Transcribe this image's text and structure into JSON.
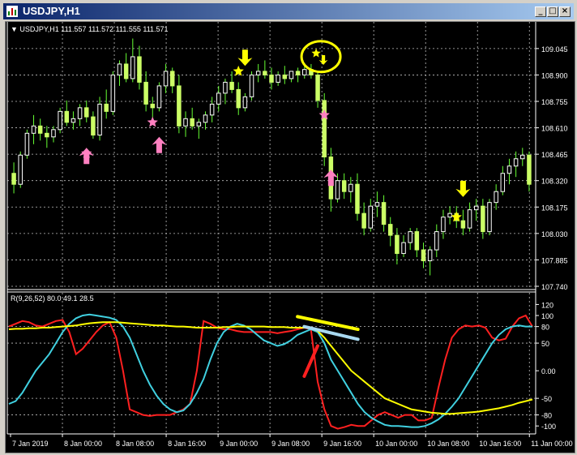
{
  "window": {
    "title": "USDJPY,H1"
  },
  "chart_data": [
    {
      "type": "candlestick",
      "info_line": "▼ USDJPY,H1  111.557 111.572 111.555 111.571",
      "symbol_label": "USDJPY,H1",
      "ohlc_text": "111.557 111.572 111.555 111.571",
      "y_ticks": [
        "109.045",
        "108.900",
        "108.755",
        "108.610",
        "108.465",
        "108.320",
        "108.175",
        "108.030",
        "107.885",
        "107.740"
      ],
      "ylim": [
        107.74,
        109.12
      ],
      "x_ticks": [
        "7 Jan 2019",
        "8 Jan 00:00",
        "8 Jan 08:00",
        "8 Jan 16:00",
        "9 Jan 00:00",
        "9 Jan 08:00",
        "9 Jan 16:00",
        "10 Jan 00:00",
        "10 Jan 08:00",
        "10 Jan 16:00",
        "11 Jan 00:00"
      ],
      "grid": true,
      "candles": [
        [
          108.36,
          108.42,
          108.25,
          108.3
        ],
        [
          108.3,
          108.48,
          108.28,
          108.46
        ],
        [
          108.46,
          108.6,
          108.44,
          108.58
        ],
        [
          108.58,
          108.68,
          108.52,
          108.62
        ],
        [
          108.62,
          108.66,
          108.54,
          108.58
        ],
        [
          108.58,
          108.62,
          108.5,
          108.56
        ],
        [
          108.56,
          108.62,
          108.53,
          108.6
        ],
        [
          108.6,
          108.72,
          108.58,
          108.7
        ],
        [
          108.7,
          108.76,
          108.62,
          108.64
        ],
        [
          108.64,
          108.7,
          108.6,
          108.66
        ],
        [
          108.66,
          108.74,
          108.62,
          108.72
        ],
        [
          108.72,
          108.76,
          108.64,
          108.67
        ],
        [
          108.67,
          108.7,
          108.55,
          108.57
        ],
        [
          108.57,
          108.78,
          108.54,
          108.74
        ],
        [
          108.74,
          108.82,
          108.66,
          108.7
        ],
        [
          108.7,
          108.92,
          108.68,
          108.9
        ],
        [
          108.9,
          108.98,
          108.84,
          108.96
        ],
        [
          108.96,
          109.02,
          108.86,
          108.88
        ],
        [
          108.88,
          109.1,
          108.86,
          109.0
        ],
        [
          109.0,
          109.06,
          108.82,
          108.86
        ],
        [
          108.86,
          108.92,
          108.7,
          108.74
        ],
        [
          108.74,
          108.78,
          108.66,
          108.72
        ],
        [
          108.72,
          108.86,
          108.7,
          108.84
        ],
        [
          108.84,
          108.96,
          108.8,
          108.92
        ],
        [
          108.92,
          108.94,
          108.8,
          108.84
        ],
        [
          108.84,
          108.9,
          108.58,
          108.62
        ],
        [
          108.62,
          108.7,
          108.56,
          108.66
        ],
        [
          108.66,
          108.72,
          108.6,
          108.62
        ],
        [
          108.62,
          108.66,
          108.55,
          108.64
        ],
        [
          108.64,
          108.7,
          108.6,
          108.68
        ],
        [
          108.68,
          108.78,
          108.64,
          108.74
        ],
        [
          108.74,
          108.84,
          108.7,
          108.8
        ],
        [
          108.8,
          108.88,
          108.74,
          108.86
        ],
        [
          108.86,
          108.92,
          108.8,
          108.82
        ],
        [
          108.82,
          108.86,
          108.68,
          108.72
        ],
        [
          108.72,
          108.8,
          108.7,
          108.78
        ],
        [
          108.78,
          108.92,
          108.76,
          108.9
        ],
        [
          108.9,
          108.96,
          108.86,
          108.92
        ],
        [
          108.92,
          108.98,
          108.88,
          108.9
        ],
        [
          108.9,
          108.94,
          108.82,
          108.86
        ],
        [
          108.86,
          108.92,
          108.84,
          108.9
        ],
        [
          108.9,
          108.95,
          108.85,
          108.88
        ],
        [
          108.88,
          108.92,
          108.86,
          108.92
        ],
        [
          108.92,
          108.94,
          108.86,
          108.9
        ],
        [
          108.9,
          108.96,
          108.88,
          108.93
        ],
        [
          108.93,
          108.96,
          108.88,
          108.9
        ],
        [
          108.9,
          108.92,
          108.72,
          108.76
        ],
        [
          108.76,
          108.8,
          108.4,
          108.45
        ],
        [
          108.45,
          108.5,
          108.15,
          108.22
        ],
        [
          108.22,
          108.36,
          108.2,
          108.32
        ],
        [
          108.32,
          108.36,
          108.22,
          108.26
        ],
        [
          108.26,
          108.34,
          108.2,
          108.3
        ],
        [
          108.3,
          108.36,
          108.1,
          108.14
        ],
        [
          108.14,
          108.2,
          108.02,
          108.06
        ],
        [
          108.06,
          108.22,
          108.04,
          108.18
        ],
        [
          108.18,
          108.26,
          108.12,
          108.2
        ],
        [
          108.2,
          108.24,
          108.04,
          108.08
        ],
        [
          108.08,
          108.12,
          107.96,
          108.02
        ],
        [
          108.02,
          108.06,
          107.86,
          107.92
        ],
        [
          107.92,
          108.02,
          107.9,
          107.98
        ],
        [
          107.98,
          108.06,
          107.94,
          108.04
        ],
        [
          108.04,
          108.06,
          107.9,
          107.94
        ],
        [
          107.94,
          107.98,
          107.84,
          107.88
        ],
        [
          107.88,
          107.96,
          107.8,
          107.94
        ],
        [
          107.94,
          108.08,
          107.9,
          108.04
        ],
        [
          108.04,
          108.16,
          108.0,
          108.12
        ],
        [
          108.12,
          108.18,
          108.08,
          108.14
        ],
        [
          108.14,
          108.18,
          108.06,
          108.1
        ],
        [
          108.1,
          108.16,
          108.02,
          108.06
        ],
        [
          108.06,
          108.2,
          108.04,
          108.16
        ],
        [
          108.16,
          108.22,
          108.1,
          108.18
        ],
        [
          108.18,
          108.22,
          108.0,
          108.04
        ],
        [
          108.04,
          108.22,
          108.02,
          108.2
        ],
        [
          108.2,
          108.3,
          108.16,
          108.26
        ],
        [
          108.26,
          108.4,
          108.24,
          108.36
        ],
        [
          108.36,
          108.44,
          108.3,
          108.4
        ],
        [
          108.4,
          108.48,
          108.34,
          108.44
        ],
        [
          108.44,
          108.5,
          108.4,
          108.46
        ],
        [
          108.46,
          108.48,
          108.26,
          108.3
        ]
      ],
      "signals": [
        {
          "i": 11,
          "kind": "up-arrow",
          "color": "#ff80c0",
          "price": 108.5
        },
        {
          "i": 11,
          "kind": "star",
          "color": "#ff80c0",
          "price": 108.47
        },
        {
          "i": 21,
          "kind": "star",
          "color": "#ff80c0",
          "price": 108.64
        },
        {
          "i": 22,
          "kind": "up-arrow",
          "color": "#ff80c0",
          "price": 108.56
        },
        {
          "i": 34,
          "kind": "star",
          "color": "#ffff00",
          "price": 108.92
        },
        {
          "i": 35,
          "kind": "down-arrow",
          "color": "#ffff00",
          "price": 108.95
        },
        {
          "i": 46,
          "kind": "circled-star",
          "color": "#ffff00",
          "price": 109.01
        },
        {
          "i": 46,
          "kind": "down-arrow-small",
          "color": "#ffff00",
          "price": 109.0
        },
        {
          "i": 47,
          "kind": "star",
          "color": "#ff80c0",
          "price": 108.68
        },
        {
          "i": 48,
          "kind": "up-arrow",
          "color": "#ff80c0",
          "price": 108.38
        },
        {
          "i": 67,
          "kind": "star",
          "color": "#ffff00",
          "price": 108.12
        },
        {
          "i": 68,
          "kind": "down-arrow",
          "color": "#ffff00",
          "price": 108.23
        }
      ],
      "colors": {
        "bull": "#ffffff",
        "bear": "#ccff66",
        "wick": "#66ff33",
        "grid": "#c0c0c0"
      }
    },
    {
      "type": "line",
      "label": "R(9,26,52) 80.0 49.1 28.5",
      "y_ticks": [
        "120",
        "100",
        "80",
        "50",
        "0.00",
        "-50",
        "-80",
        "-100"
      ],
      "ylim": [
        -110,
        125
      ],
      "level_lines": [
        80,
        50,
        -50,
        -80
      ],
      "series": [
        {
          "color": "#ff2020",
          "values": [
            80,
            85,
            90,
            88,
            82,
            80,
            85,
            90,
            92,
            70,
            30,
            40,
            55,
            70,
            82,
            88,
            60,
            0,
            -70,
            -75,
            -80,
            -82,
            -80,
            -80,
            -80,
            -75,
            -70,
            -60,
            0,
            90,
            85,
            78,
            75,
            75,
            72,
            70,
            70,
            70,
            70,
            70,
            68,
            70,
            72,
            75,
            78,
            75,
            -20,
            -70,
            -100,
            -105,
            -102,
            -98,
            -100,
            -100,
            -90,
            -80,
            -75,
            -80,
            -85,
            -80,
            -80,
            -90,
            -90,
            -85,
            -30,
            20,
            60,
            75,
            82,
            80,
            82,
            78,
            60,
            55,
            58,
            80,
            95,
            100,
            80
          ]
        },
        {
          "color": "#40d0e0",
          "values": [
            -60,
            -55,
            -40,
            -20,
            0,
            15,
            30,
            50,
            70,
            85,
            95,
            100,
            102,
            100,
            98,
            96,
            92,
            80,
            60,
            30,
            0,
            -25,
            -45,
            -60,
            -70,
            -75,
            -72,
            -60,
            -40,
            -15,
            20,
            50,
            70,
            80,
            85,
            82,
            75,
            65,
            55,
            50,
            45,
            48,
            55,
            65,
            70,
            75,
            70,
            50,
            20,
            0,
            -20,
            -40,
            -60,
            -75,
            -85,
            -92,
            -98,
            -100,
            -100,
            -101,
            -102,
            -102,
            -100,
            -95,
            -88,
            -78,
            -65,
            -50,
            -30,
            -10,
            10,
            30,
            50,
            65,
            75,
            80,
            82,
            80,
            80
          ]
        },
        {
          "color": "#ffff00",
          "values": [
            75,
            76,
            76,
            77,
            77,
            78,
            78,
            79,
            80,
            81,
            82,
            84,
            86,
            87,
            88,
            88,
            88,
            87,
            86,
            85,
            84,
            83,
            82,
            82,
            81,
            80,
            80,
            79,
            78,
            78,
            78,
            78,
            79,
            79,
            80,
            80,
            80,
            80,
            80,
            79,
            79,
            79,
            78,
            78,
            78,
            77,
            72,
            60,
            45,
            30,
            15,
            0,
            -10,
            -20,
            -30,
            -40,
            -50,
            -55,
            -60,
            -65,
            -70,
            -72,
            -74,
            -76,
            -77,
            -78,
            -78,
            -77,
            -76,
            -75,
            -74,
            -72,
            -70,
            -68,
            -65,
            -62,
            -58,
            -55,
            -52
          ]
        }
      ],
      "annotations": [
        {
          "kind": "line",
          "color": "#ffff00",
          "from": [
            43,
            98
          ],
          "to": [
            52,
            75
          ]
        },
        {
          "kind": "line",
          "color": "#a8d8f0",
          "from": [
            44,
            80
          ],
          "to": [
            52,
            57
          ]
        },
        {
          "kind": "line",
          "color": "#ff2020",
          "from": [
            44,
            -10
          ],
          "to": [
            46,
            45
          ]
        }
      ]
    }
  ]
}
